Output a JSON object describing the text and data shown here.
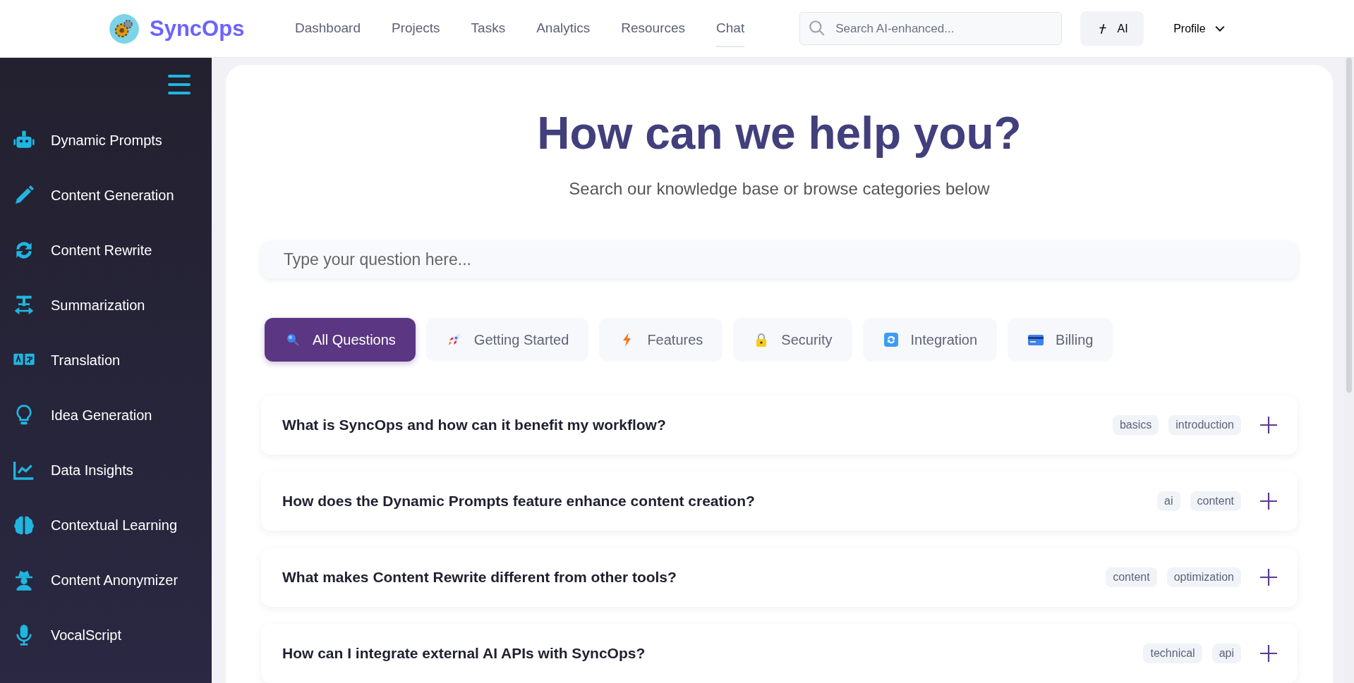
{
  "header": {
    "brand": "SyncOps",
    "nav": [
      {
        "label": "Dashboard",
        "selected": false
      },
      {
        "label": "Projects",
        "selected": false
      },
      {
        "label": "Tasks",
        "selected": false
      },
      {
        "label": "Analytics",
        "selected": false
      },
      {
        "label": "Resources",
        "selected": false
      },
      {
        "label": "Chat",
        "selected": true
      }
    ],
    "search": {
      "placeholder": "Search AI-enhanced..."
    },
    "ai_button": "AI",
    "profile": "Profile"
  },
  "sidebar": {
    "items": [
      {
        "label": "Dynamic Prompts"
      },
      {
        "label": "Content Generation"
      },
      {
        "label": "Content Rewrite"
      },
      {
        "label": "Summarization"
      },
      {
        "label": "Translation"
      },
      {
        "label": "Idea Generation"
      },
      {
        "label": "Data Insights"
      },
      {
        "label": "Contextual Learning"
      },
      {
        "label": "Content Anonymizer"
      },
      {
        "label": "VocalScript"
      }
    ]
  },
  "main": {
    "title": "How can we help you?",
    "subtitle": "Search our knowledge base or browse categories below",
    "question_field": {
      "placeholder": "Type your question here..."
    },
    "categories": [
      {
        "label": "All Questions",
        "selected": true
      },
      {
        "label": "Getting Started",
        "selected": false
      },
      {
        "label": "Features",
        "selected": false
      },
      {
        "label": "Security",
        "selected": false
      },
      {
        "label": "Integration",
        "selected": false
      },
      {
        "label": "Billing",
        "selected": false
      }
    ],
    "faqs": [
      {
        "question": "What is SyncOps and how can it benefit my workflow?",
        "tags": [
          "basics",
          "introduction"
        ],
        "expanded": false
      },
      {
        "question": "How does the Dynamic Prompts feature enhance content creation?",
        "tags": [
          "ai",
          "content"
        ],
        "expanded": false
      },
      {
        "question": "What makes Content Rewrite different from other tools?",
        "tags": [
          "content",
          "optimization"
        ],
        "expanded": false
      },
      {
        "question": "How can I integrate external AI APIs with SyncOps?",
        "tags": [
          "technical",
          "api"
        ],
        "expanded": false
      }
    ]
  }
}
